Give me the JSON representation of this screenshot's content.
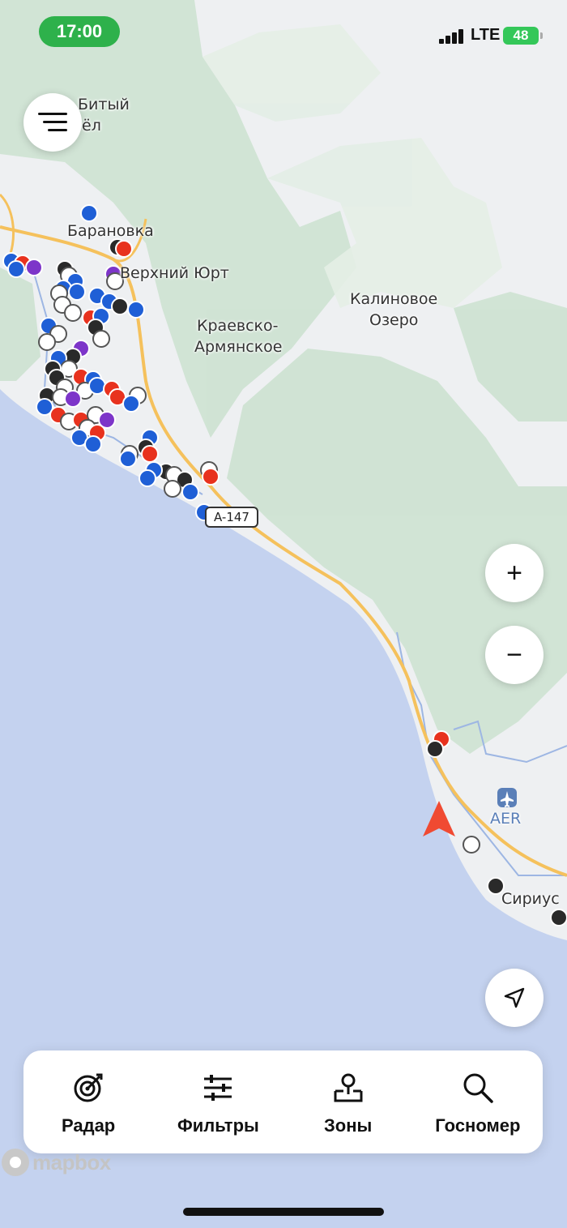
{
  "status_bar": {
    "time": "17:00",
    "network": "LTE",
    "battery": "48"
  },
  "map": {
    "place_labels": [
      {
        "id": "cut-a",
        "text": "Битый"
      },
      {
        "id": "cut-b",
        "text": "ёл"
      },
      {
        "id": "baranovka",
        "text": "Барановка"
      },
      {
        "id": "verkhniy-yurt",
        "text": "Верхний Юрт"
      },
      {
        "id": "kalinovoe-1",
        "text": "Калиновое"
      },
      {
        "id": "kalinovoe-2",
        "text": "Озеро"
      },
      {
        "id": "kraevsko-1",
        "text": "Краевско-"
      },
      {
        "id": "kraevsko-2",
        "text": "Армянское"
      },
      {
        "id": "aer",
        "text": "AER"
      },
      {
        "id": "sirius",
        "text": "Сириус"
      }
    ],
    "road_shield": "A-147",
    "colors": {
      "sea": "#c4d2ef",
      "land": "#eef0f2",
      "forest": "#cfe3d3",
      "road": "#f5c15c",
      "boundary": "#9db6e3",
      "marker_blue": "#1f5fd6",
      "marker_red": "#e8321e",
      "marker_black": "#2a2a2a",
      "marker_white": "#ffffff",
      "marker_purple": "#7d35c9",
      "user_arrow": "#f04a32"
    }
  },
  "controls": {
    "menu_icon": "hamburger-icon",
    "zoom_in": "+",
    "zoom_out": "−",
    "locate_icon": "navigation-arrow-icon"
  },
  "bottom_nav": [
    {
      "id": "radar",
      "label": "Радар",
      "icon": "radar-icon"
    },
    {
      "id": "filters",
      "label": "Фильтры",
      "icon": "sliders-icon"
    },
    {
      "id": "zones",
      "label": "Зоны",
      "icon": "location-pin-icon"
    },
    {
      "id": "plate",
      "label": "Госномер",
      "icon": "search-icon"
    }
  ],
  "attribution": "mapbox"
}
